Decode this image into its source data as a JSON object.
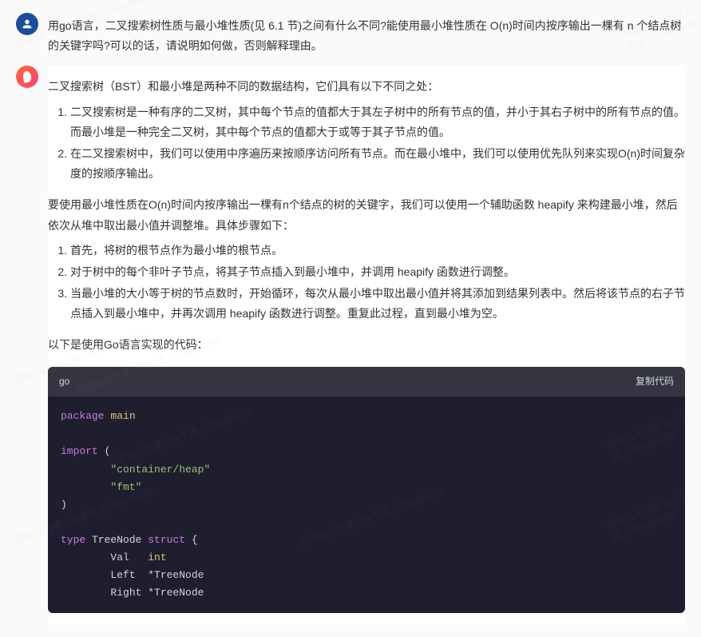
{
  "user_message": "用go语言，二叉搜索树性质与最小堆性质(见 6.1 节)之间有什么不同?能使用最小堆性质在 O(n)时间内按序输出一棵有 n 个结点树的关键字吗?可以的话，请说明如何做，否则解释理由。",
  "ai": {
    "intro": "二叉搜索树（BST）和最小堆是两种不同的数据结构，它们具有以下不同之处：",
    "diff_list": [
      "二叉搜索树是一种有序的二叉树，其中每个节点的值都大于其左子树中的所有节点的值，并小于其右子树中的所有节点的值。而最小堆是一种完全二叉树，其中每个节点的值都大于或等于其子节点的值。",
      "在二叉搜索树中，我们可以使用中序遍历来按顺序访问所有节点。而在最小堆中，我们可以使用优先队列来实现O(n)时间复杂度的按顺序输出。"
    ],
    "method_intro": "要使用最小堆性质在O(n)时间内按序输出一棵有n个结点的树的关键字，我们可以使用一个辅助函数 heapify 来构建最小堆，然后依次从堆中取出最小值并调整堆。具体步骤如下：",
    "steps": [
      "首先，将树的根节点作为最小堆的根节点。",
      "对于树中的每个非叶子节点，将其子节点插入到最小堆中，并调用 heapify 函数进行调整。",
      "当最小堆的大小等于树的节点数时，开始循环，每次从最小堆中取出最小值并将其添加到结果列表中。然后将该节点的右子节点插入到最小堆中，并再次调用 heapify 函数进行调整。重复此过程，直到最小堆为空。"
    ],
    "code_intro": "以下是使用Go语言实现的代码：",
    "code_lang": "go",
    "copy_label": "复制代码",
    "code": {
      "l1_kw": "package",
      "l1_pkg": " main",
      "l3_kw": "import",
      "l3_paren": " (",
      "l4_str": "\"container/heap\"",
      "l5_str": "\"fmt\"",
      "l6_paren": ")",
      "l8_kw": "type",
      "l8_name": " TreeNode ",
      "l8_kw2": "struct",
      "l8_brace": " {",
      "l9_field": "        Val   ",
      "l9_type": "int",
      "l10_field": "        Left  *TreeNode",
      "l11_field": "        Right *TreeNode"
    }
  },
  "watermark": "内容由讯飞星火AI生成\n2i7p4plf6u9b"
}
